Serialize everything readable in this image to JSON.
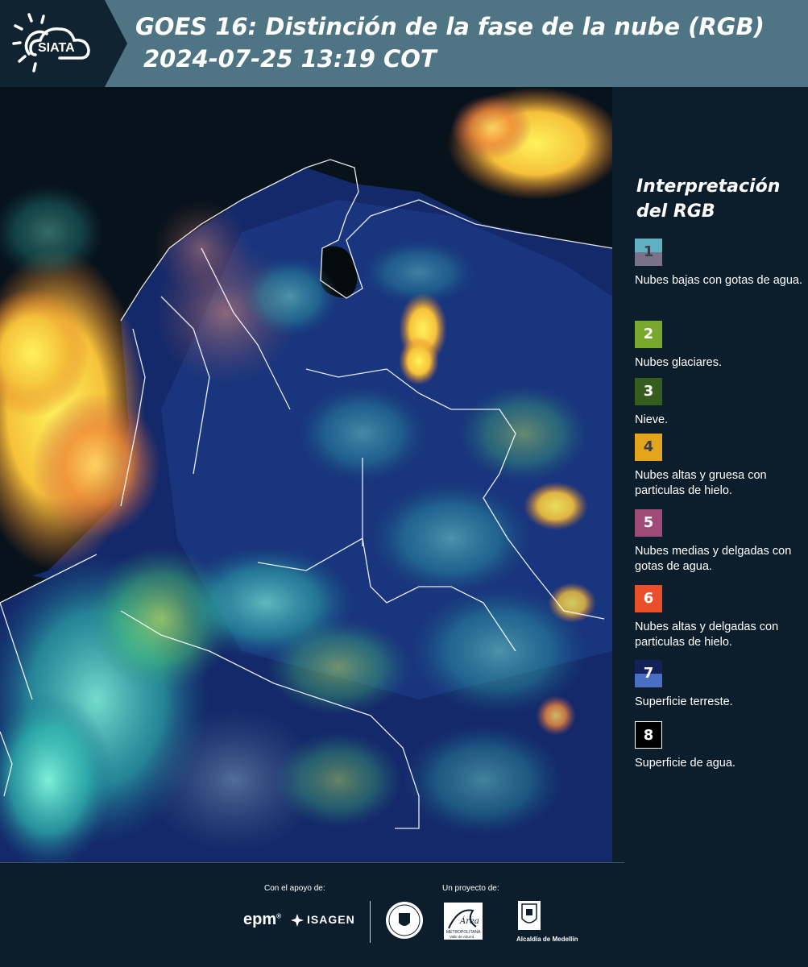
{
  "header": {
    "logo_text": "SIATA",
    "title_line1": "GOES 16: Distinción de la fase de la nube (RGB)",
    "title_line2": "2024-07-25 13:19 COT"
  },
  "map": {
    "icon": "satellite-rgb-map"
  },
  "legend": {
    "title": "Interpretación del RGB",
    "items": [
      {
        "num": "1",
        "label": "Nubes bajas con gotas de agua.",
        "color_top": "#5fb1c3",
        "color_bottom": "#7a7289",
        "text_color": "#3c3c4a"
      },
      {
        "num": "2",
        "label": "Nubes glaciares.",
        "color_top": "#78a82e",
        "color_bottom": "#78a82e",
        "text_color": "#ffffff"
      },
      {
        "num": "3",
        "label": "Nieve.",
        "color_top": "#355e1e",
        "color_bottom": "#355e1e",
        "text_color": "#ffffff"
      },
      {
        "num": "4",
        "label": "Nubes altas y gruesa con particulas de hielo.",
        "color_top": "#e3a51c",
        "color_bottom": "#e3a51c",
        "text_color": "#3c3c4a"
      },
      {
        "num": "5",
        "label": "Nubes medias y delgadas con gotas de agua.",
        "color_top": "#a04a78",
        "color_bottom": "#a04a78",
        "text_color": "#ffffff"
      },
      {
        "num": "6",
        "label": "Nubes altas y delgadas con particulas de hielo.",
        "color_top": "#ea4f2c",
        "color_bottom": "#ea4f2c",
        "text_color": "#ffffff"
      },
      {
        "num": "7",
        "label": "Superficie terreste.",
        "color_top": "#13215a",
        "color_bottom": "#4a6fc2",
        "text_color": "#ffffff"
      },
      {
        "num": "8",
        "label": "Superficie de agua.",
        "color_top": "#000000",
        "color_bottom": "#000000",
        "text_color": "#ffffff"
      }
    ]
  },
  "footer": {
    "support_label": "Con el apoyo de:",
    "project_label": "Un proyecto de:",
    "sponsor_1": "epm",
    "sponsor_2": "ISAGEN",
    "partner_1": "METROPOLITANA",
    "partner_1_sub": "Valle de Aburrá",
    "partner_2": "Alcaldía de Medellín"
  }
}
